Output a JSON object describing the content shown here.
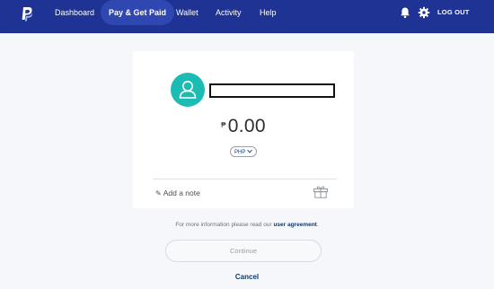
{
  "nav": {
    "items": [
      {
        "label": "Dashboard"
      },
      {
        "label": "Pay & Get Paid",
        "active": true
      },
      {
        "label": "Wallet"
      },
      {
        "label": "Activity"
      },
      {
        "label": "Help"
      }
    ],
    "logout_label": "LOG OUT",
    "icons": [
      "paypal-logo",
      "bell-icon",
      "gear-icon"
    ]
  },
  "card": {
    "recipient_name": "",
    "currency_symbol": "₱",
    "amount": "0.00",
    "currency_label": "PHP",
    "note_label": "Add a note"
  },
  "footer": {
    "info_prefix": "For more information please read our",
    "info_link": "user agreement",
    "info_suffix": ".",
    "continue_label": "Continue",
    "cancel_label": "Cancel"
  },
  "colors": {
    "header": "#1f3394",
    "accent": "#1cbcb4",
    "link": "#0c3b73",
    "background": "#f5f7fa"
  }
}
